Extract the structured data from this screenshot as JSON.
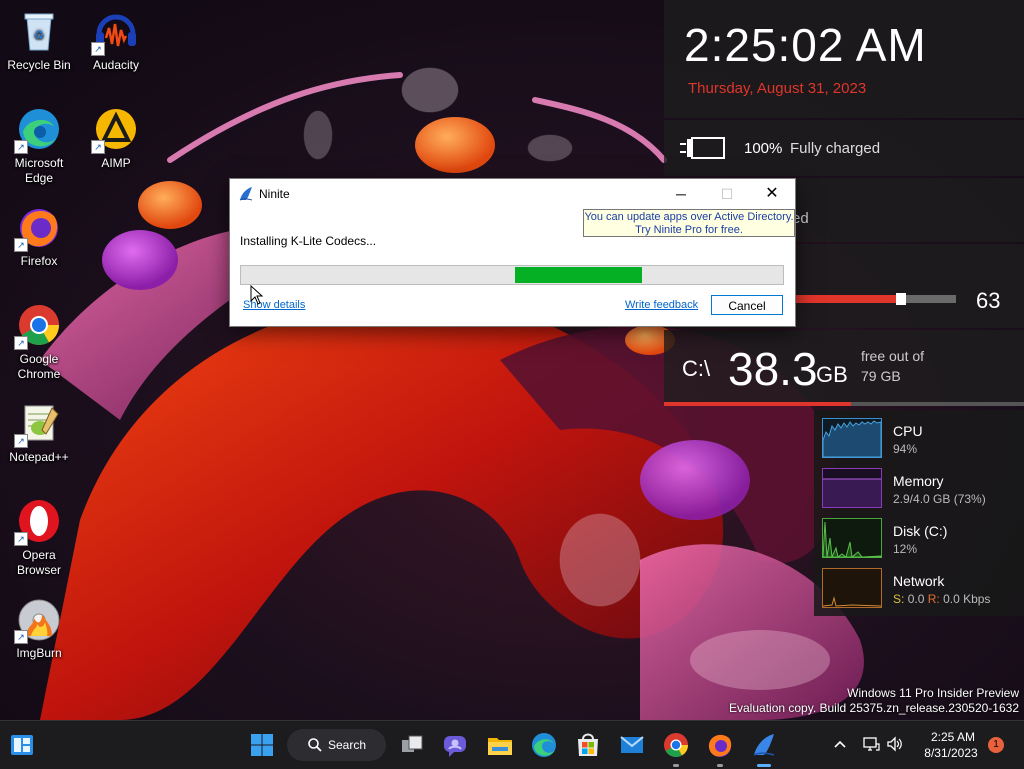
{
  "desktop": {
    "icons": [
      {
        "label": "Recycle Bin"
      },
      {
        "label": "Audacity"
      },
      {
        "label": "Microsoft Edge"
      },
      {
        "label": "AIMP"
      },
      {
        "label": "Firefox"
      },
      {
        "label": "Google Chrome"
      },
      {
        "label": "Notepad++"
      },
      {
        "label": "Opera Browser"
      },
      {
        "label": "ImgBurn"
      }
    ]
  },
  "widgets": {
    "clock": {
      "time": "2:25:02 AM",
      "date": "Thursday, August 31, 2023"
    },
    "battery": {
      "percent": "100%",
      "status": "Fully charged"
    },
    "partial": {
      "text": "ed"
    },
    "volume": {
      "value": "63",
      "level": 0.63
    },
    "disk": {
      "drive": "C:\\",
      "free": "38.3",
      "unit": "GB",
      "sub_line1": "free out of",
      "sub_line2": "79 GB",
      "used_fraction": 0.52
    }
  },
  "perf_monitor": {
    "cpu": {
      "name": "CPU",
      "value": "94%"
    },
    "memory": {
      "name": "Memory",
      "value": "2.9/4.0 GB (73%)"
    },
    "disk": {
      "name": "Disk (C:)",
      "value": "12%"
    },
    "network": {
      "name": "Network",
      "send_label": "S:",
      "send_value": "0.0",
      "recv_label": "R:",
      "recv_value": "0.0 Kbps"
    }
  },
  "watermark": {
    "line1": "Windows 11 Pro Insider Preview",
    "line2": "Evaluation copy. Build 25375.zn_release.230520-1632"
  },
  "ninite": {
    "title": "Ninite",
    "tooltip_line1": "You can update apps over Active Directory.",
    "tooltip_line2": "Try Ninite Pro for free.",
    "status": "Installing K-Lite Codecs...",
    "progress_marquee": {
      "start": 0.505,
      "end": 0.74
    },
    "show_details": "Show details",
    "write_feedback": "Write feedback",
    "cancel": "Cancel"
  },
  "taskbar": {
    "search_label": "Search",
    "clock_time": "2:25 AM",
    "clock_date": "8/31/2023",
    "notification_count": "1",
    "pinned": [
      "widgets-icon",
      "start-icon",
      "task-view-icon",
      "chat-icon",
      "file-explorer-icon",
      "edge-icon",
      "store-icon",
      "mail-icon",
      "chrome-icon",
      "firefox-icon",
      "ninite-icon"
    ]
  },
  "colors": {
    "accent_red": "#e0352b",
    "progress_green": "#06b025",
    "link_blue": "#0066cc"
  }
}
